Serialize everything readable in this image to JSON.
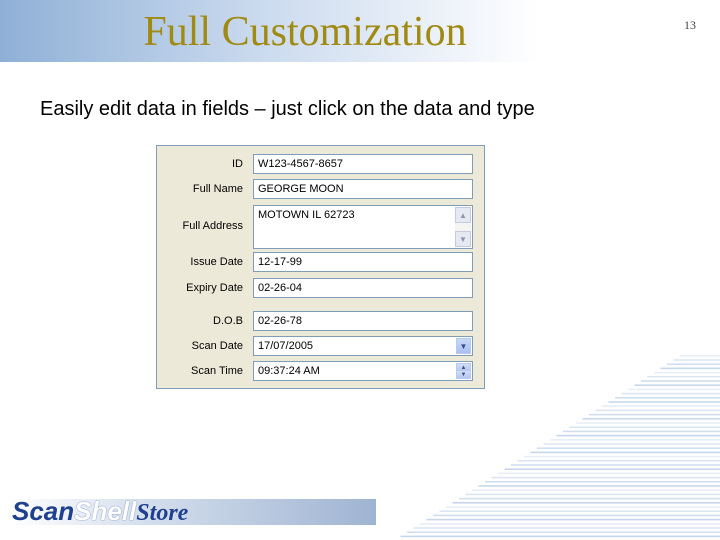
{
  "slide": {
    "title": "Full Customization",
    "number": "13",
    "subtitle": "Easily edit data in fields – just click on the data and type"
  },
  "form": {
    "fields": [
      {
        "label": "ID",
        "value": "W123-4567-8657"
      },
      {
        "label": "Full Name",
        "value": "GEORGE MOON"
      },
      {
        "label": "Full Address",
        "value": "MOTOWN IL 62723"
      },
      {
        "label": "Issue Date",
        "value": "12-17-99"
      },
      {
        "label": "Expiry Date",
        "value": "02-26-04"
      },
      {
        "label": "D.O.B",
        "value": "02-26-78"
      },
      {
        "label": "Scan Date",
        "value": "17/07/2005"
      },
      {
        "label": "Scan Time",
        "value": "09:37:24 AM"
      }
    ]
  },
  "logo": {
    "part1": "Scan",
    "part2": "Shell",
    "part3": "Store"
  },
  "colors": {
    "title": "#a08a12",
    "panel_bg": "#ece9d8",
    "field_border": "#7f9db9",
    "accent": "#1f3f8f"
  }
}
